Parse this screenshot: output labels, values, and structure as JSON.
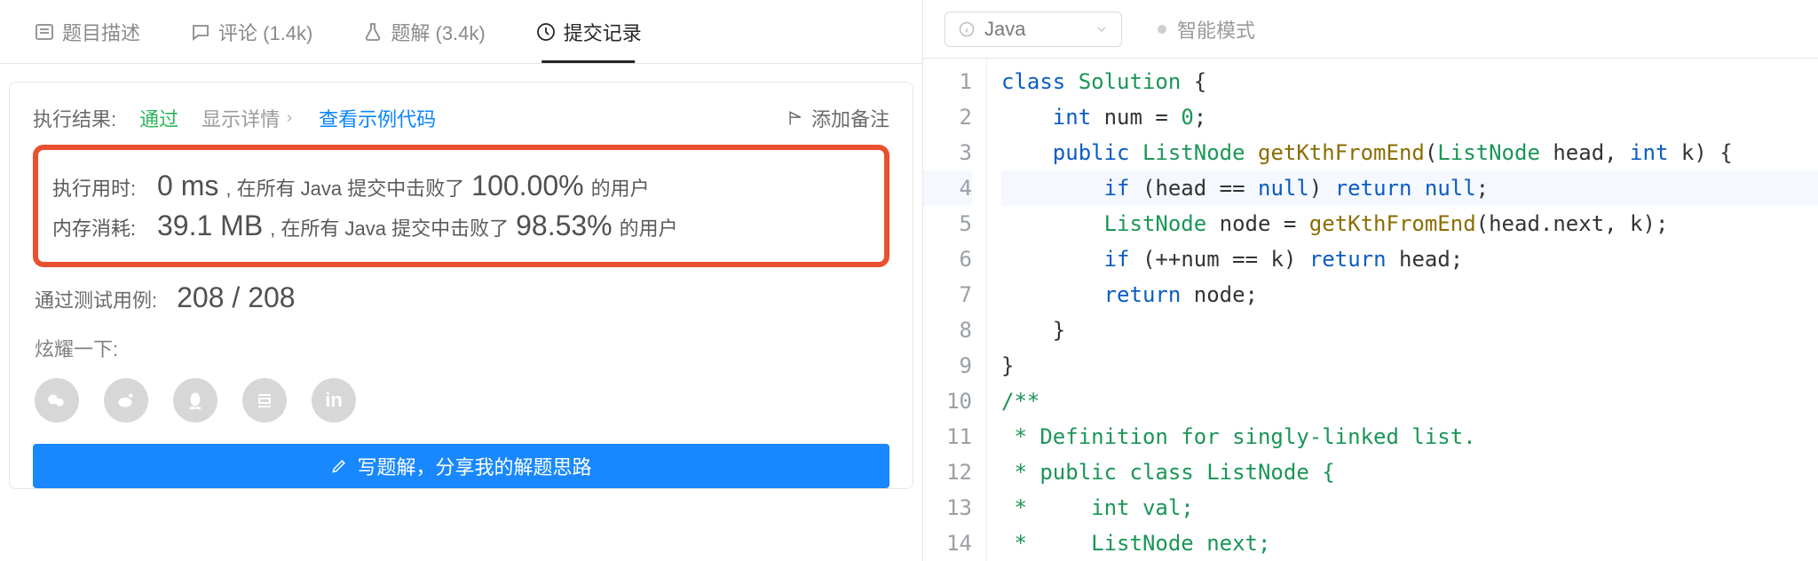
{
  "tabs": {
    "description": "题目描述",
    "comments": "评论 (1.4k)",
    "solutions": "题解 (3.4k)",
    "submissions": "提交记录"
  },
  "result": {
    "label": "执行结果:",
    "status": "通过",
    "showDetail": "显示详情",
    "exampleCode": "查看示例代码",
    "addRemark": "添加备注"
  },
  "runtime": {
    "label": "执行用时:",
    "value": "0 ms",
    "middle": ", 在所有 Java 提交中击败了",
    "percent": "100.00%",
    "suffix": "的用户"
  },
  "memory": {
    "label": "内存消耗:",
    "value": "39.1 MB",
    "middle": ", 在所有 Java 提交中击败了",
    "percent": "98.53%",
    "suffix": "的用户"
  },
  "testcases": {
    "label": "通过测试用例:",
    "value": "208 / 208"
  },
  "share": {
    "label": "炫耀一下:"
  },
  "writeBtn": "写题解，分享我的解题思路",
  "toolbar": {
    "lang": "Java",
    "mode": "智能模式"
  },
  "code": {
    "lineStart": 1,
    "lines": [
      [
        [
          "kw",
          "class"
        ],
        [
          "sp",
          " "
        ],
        [
          "type",
          "Solution"
        ],
        [
          "sp",
          " "
        ],
        [
          "op",
          "{"
        ]
      ],
      [
        [
          "sp",
          "    "
        ],
        [
          "kw",
          "int"
        ],
        [
          "sp",
          " "
        ],
        [
          "id",
          "num"
        ],
        [
          "sp",
          " "
        ],
        [
          "op",
          "="
        ],
        [
          "sp",
          " "
        ],
        [
          "num",
          "0"
        ],
        [
          "op",
          ";"
        ]
      ],
      [
        [
          "sp",
          "    "
        ],
        [
          "kw",
          "public"
        ],
        [
          "sp",
          " "
        ],
        [
          "type",
          "ListNode"
        ],
        [
          "sp",
          " "
        ],
        [
          "meth",
          "getKthFromEnd"
        ],
        [
          "op",
          "("
        ],
        [
          "type",
          "ListNode"
        ],
        [
          "sp",
          " "
        ],
        [
          "id",
          "head"
        ],
        [
          "op",
          ","
        ],
        [
          "sp",
          " "
        ],
        [
          "kw",
          "int"
        ],
        [
          "sp",
          " "
        ],
        [
          "id",
          "k"
        ],
        [
          "op",
          ")"
        ],
        [
          "sp",
          " "
        ],
        [
          "op",
          "{"
        ]
      ],
      [
        [
          "sp",
          "        "
        ],
        [
          "kw",
          "if"
        ],
        [
          "sp",
          " "
        ],
        [
          "op",
          "("
        ],
        [
          "id",
          "head"
        ],
        [
          "sp",
          " "
        ],
        [
          "op",
          "=="
        ],
        [
          "sp",
          " "
        ],
        [
          "kw",
          "null"
        ],
        [
          "op",
          ")"
        ],
        [
          "sp",
          " "
        ],
        [
          "kw",
          "return"
        ],
        [
          "sp",
          " "
        ],
        [
          "kw",
          "null"
        ],
        [
          "op",
          ";"
        ]
      ],
      [
        [
          "sp",
          "        "
        ],
        [
          "type",
          "ListNode"
        ],
        [
          "sp",
          " "
        ],
        [
          "id",
          "node"
        ],
        [
          "sp",
          " "
        ],
        [
          "op",
          "="
        ],
        [
          "sp",
          " "
        ],
        [
          "meth",
          "getKthFromEnd"
        ],
        [
          "op",
          "("
        ],
        [
          "id",
          "head"
        ],
        [
          "op",
          "."
        ],
        [
          "id",
          "next"
        ],
        [
          "op",
          ","
        ],
        [
          "sp",
          " "
        ],
        [
          "id",
          "k"
        ],
        [
          "op",
          ")"
        ],
        [
          "op",
          ";"
        ]
      ],
      [
        [
          "sp",
          "        "
        ],
        [
          "kw",
          "if"
        ],
        [
          "sp",
          " "
        ],
        [
          "op",
          "("
        ],
        [
          "op",
          "++"
        ],
        [
          "id",
          "num"
        ],
        [
          "sp",
          " "
        ],
        [
          "op",
          "=="
        ],
        [
          "sp",
          " "
        ],
        [
          "id",
          "k"
        ],
        [
          "op",
          ")"
        ],
        [
          "sp",
          " "
        ],
        [
          "kw",
          "return"
        ],
        [
          "sp",
          " "
        ],
        [
          "id",
          "head"
        ],
        [
          "op",
          ";"
        ]
      ],
      [
        [
          "sp",
          "        "
        ],
        [
          "kw",
          "return"
        ],
        [
          "sp",
          " "
        ],
        [
          "id",
          "node"
        ],
        [
          "op",
          ";"
        ]
      ],
      [
        [
          "sp",
          "    "
        ],
        [
          "op",
          "}"
        ]
      ],
      [
        [
          "op",
          "}"
        ]
      ],
      [
        [
          "comment",
          "/**"
        ]
      ],
      [
        [
          "comment",
          " * Definition for singly-linked list."
        ]
      ],
      [
        [
          "comment",
          " * public class ListNode {"
        ]
      ],
      [
        [
          "comment",
          " *     int val;"
        ]
      ],
      [
        [
          "comment",
          " *     ListNode next;"
        ]
      ]
    ],
    "activeLine": 4
  }
}
